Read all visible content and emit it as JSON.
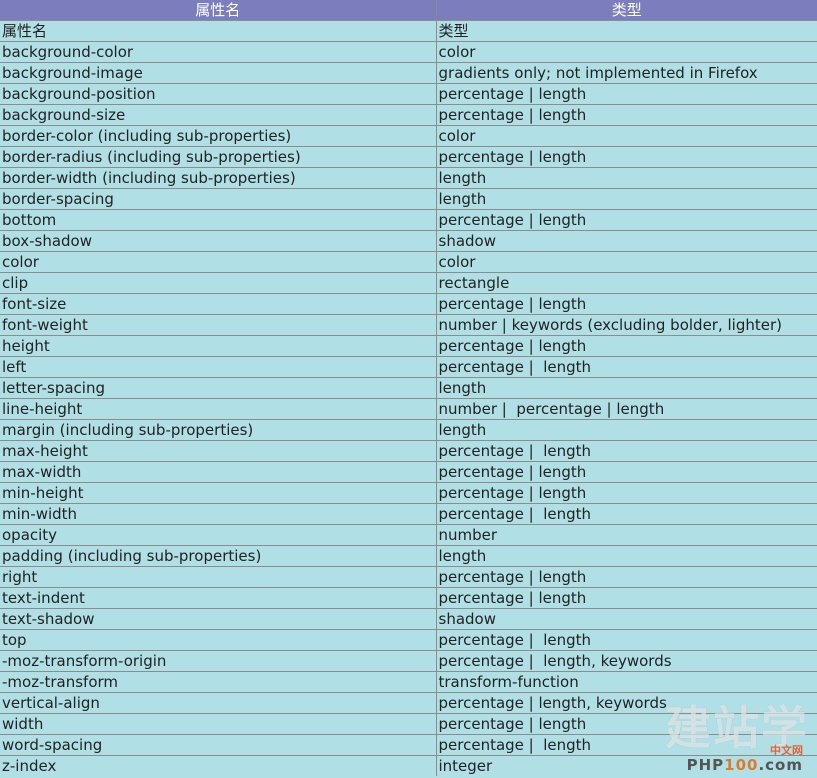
{
  "table": {
    "headers": [
      "属性名",
      "类型"
    ],
    "rows": [
      [
        "属性名",
        "类型"
      ],
      [
        "background-color",
        "color"
      ],
      [
        "background-image",
        "gradients only; not implemented in Firefox"
      ],
      [
        "background-position",
        "percentage | length"
      ],
      [
        "background-size",
        "percentage | length"
      ],
      [
        "border-color (including sub-properties)",
        "color"
      ],
      [
        "border-radius (including sub-properties)",
        "percentage | length"
      ],
      [
        "border-width (including sub-properties)",
        "length"
      ],
      [
        "border-spacing",
        "length"
      ],
      [
        "bottom",
        "percentage | length"
      ],
      [
        "box-shadow",
        "shadow"
      ],
      [
        "color",
        "color"
      ],
      [
        "clip",
        "rectangle"
      ],
      [
        "font-size",
        "percentage | length"
      ],
      [
        "font-weight",
        "number | keywords (excluding bolder, lighter)"
      ],
      [
        "height",
        "percentage | length"
      ],
      [
        "left",
        "percentage |  length"
      ],
      [
        "letter-spacing",
        "length"
      ],
      [
        "line-height",
        "number |  percentage | length"
      ],
      [
        "margin (including sub-properties)",
        "length"
      ],
      [
        "max-height",
        "percentage |  length"
      ],
      [
        "max-width",
        "percentage | length"
      ],
      [
        "min-height",
        "percentage | length"
      ],
      [
        "min-width",
        "percentage |  length"
      ],
      [
        "opacity",
        "number"
      ],
      [
        "padding (including sub-properties)",
        "length"
      ],
      [
        "right",
        "percentage | length"
      ],
      [
        "text-indent",
        "percentage | length"
      ],
      [
        "text-shadow",
        "shadow"
      ],
      [
        "top",
        "percentage |  length"
      ],
      [
        "-moz-transform-origin",
        "percentage |  length, keywords"
      ],
      [
        "-moz-transform",
        "transform-function"
      ],
      [
        "vertical-align",
        "percentage | length, keywords"
      ],
      [
        "width",
        "percentage | length"
      ],
      [
        "word-spacing",
        "percentage |  length"
      ],
      [
        "z-index",
        "integer"
      ]
    ]
  },
  "watermark": {
    "main": "建站学",
    "cn": "中文网",
    "brand_prefix": "PHP",
    "brand_highlight": "100",
    "brand_suffix": ".com"
  }
}
